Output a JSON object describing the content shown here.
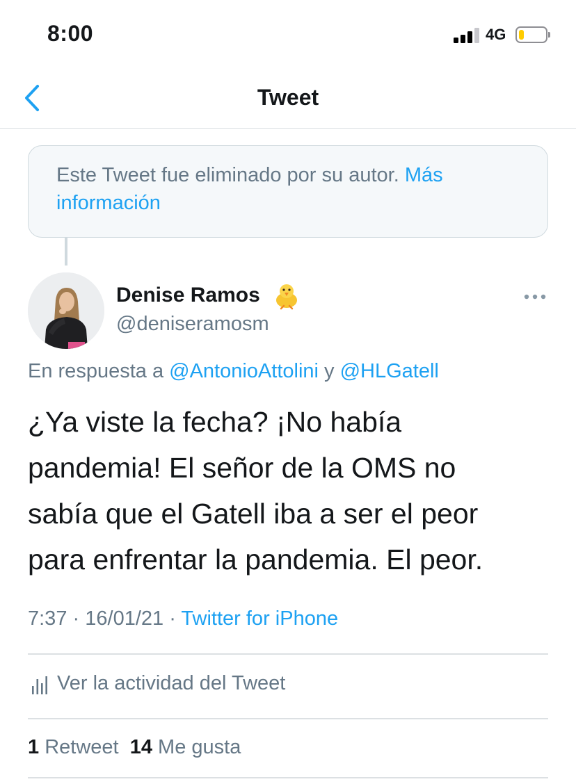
{
  "status_bar": {
    "time": "8:00",
    "network": "4G",
    "battery_level": 0.2,
    "battery_color": "#ffcc00"
  },
  "nav": {
    "title": "Tweet",
    "back_icon": "chevron-left-icon"
  },
  "deleted_notice": {
    "text": "Este Tweet fue eliminado por su autor.",
    "link": "Más información"
  },
  "tweet": {
    "author": {
      "name": "Denise Ramos",
      "handle": "@deniseramosm",
      "badge_icon": "baby-chick-emoji"
    },
    "reply_context": {
      "prefix": "En respuesta a",
      "mention1": "@AntonioAttolini",
      "connector": "y",
      "mention2": "@HLGatell"
    },
    "text_lines": [
      "¿Ya viste la fecha? ¡No había",
      "pandemia! El señor de la OMS no",
      "sabía que el Gatell iba a ser el peor",
      "para enfrentar la pandemia. El peor."
    ],
    "time": "7:37",
    "date": "16/01/21",
    "separator": "·",
    "source": "Twitter for iPhone"
  },
  "activity": {
    "label": "Ver la actividad del Tweet",
    "icon": "bar-chart-icon"
  },
  "stats": {
    "retweets_count": "1",
    "retweets_label": "Retweet",
    "likes_count": "14",
    "likes_label": "Me gusta"
  },
  "colors": {
    "accent": "#1da1f2",
    "secondary_text": "#657786",
    "primary_text": "#14171a"
  }
}
